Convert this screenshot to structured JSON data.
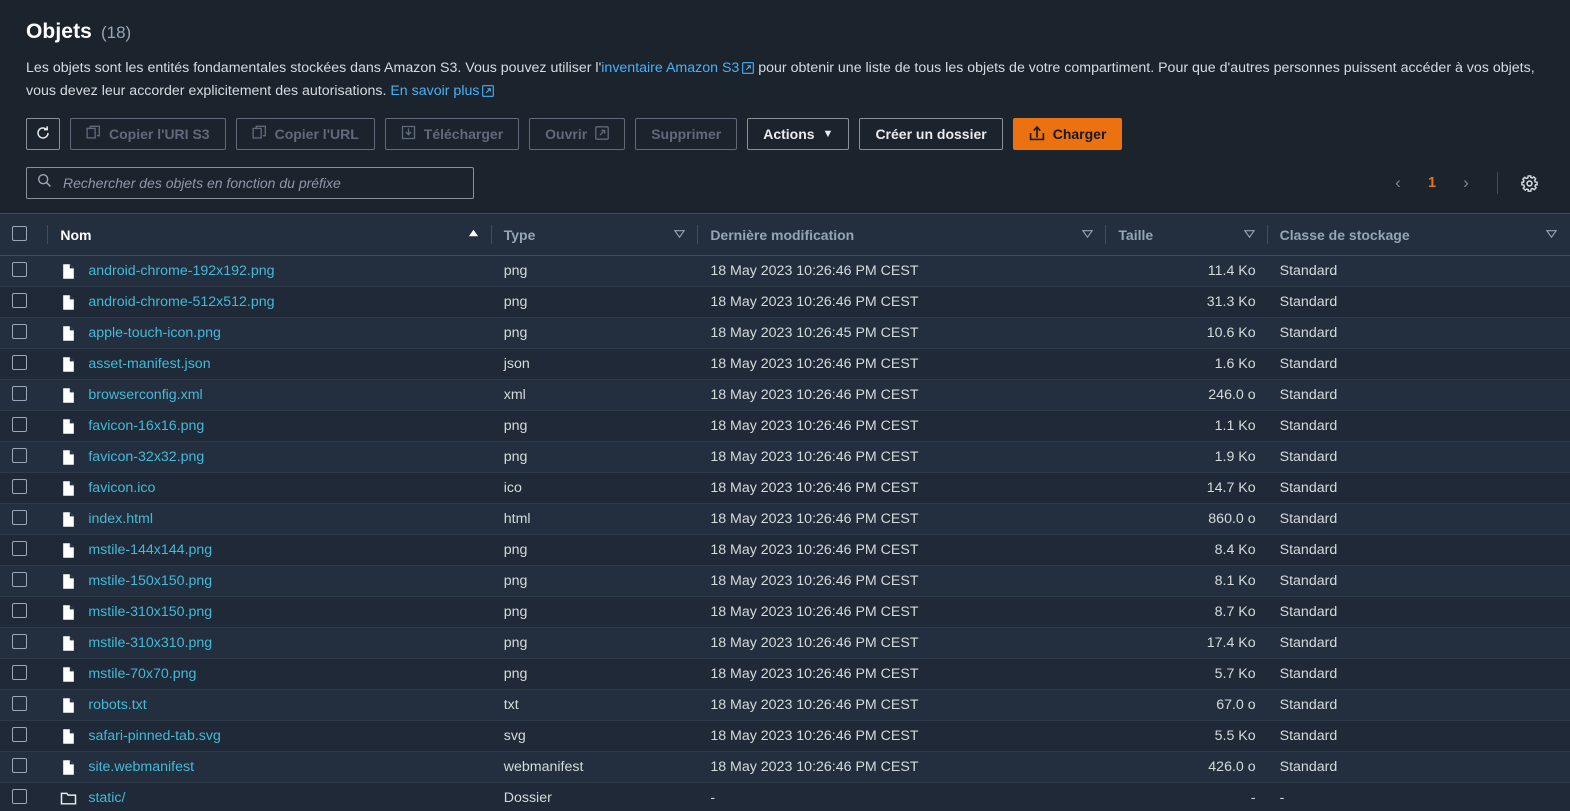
{
  "header": {
    "title": "Objets",
    "count": "(18)",
    "description_part1": "Les objets sont les entités fondamentales stockées dans Amazon S3. Vous pouvez utiliser l'",
    "inventory_link": "inventaire Amazon S3",
    "description_part2": " pour obtenir une liste de tous les objets de votre compartiment. Pour que d'autres personnes puissent accéder à vos objets, vous devez leur accorder explicitement des autorisations. ",
    "learn_more_link": "En savoir plus"
  },
  "toolbar": {
    "refresh_icon": "refresh-icon",
    "copy_uri_label": "Copier l'URI S3",
    "copy_url_label": "Copier l'URL",
    "download_label": "Télécharger",
    "open_label": "Ouvrir",
    "delete_label": "Supprimer",
    "actions_label": "Actions",
    "actions_caret": "▼",
    "create_folder_label": "Créer un dossier",
    "upload_label": "Charger"
  },
  "search": {
    "placeholder": "Rechercher des objets en fonction du préfixe",
    "value": ""
  },
  "pagination": {
    "prev": "‹",
    "page": "1",
    "next": "›",
    "settings_icon": "gear-icon"
  },
  "table": {
    "columns": [
      {
        "label": "Nom",
        "sort": "asc"
      },
      {
        "label": "Type",
        "sort": "none"
      },
      {
        "label": "Dernière modification",
        "sort": "none"
      },
      {
        "label": "Taille",
        "sort": "none"
      },
      {
        "label": "Classe de stockage",
        "sort": "none"
      }
    ],
    "rows": [
      {
        "name": "android-chrome-192x192.png",
        "icon": "file-icon",
        "type": "png",
        "modified": "18 May 2023 10:26:46 PM CEST",
        "size": "11.4 Ko",
        "storage_class": "Standard"
      },
      {
        "name": "android-chrome-512x512.png",
        "icon": "file-icon",
        "type": "png",
        "modified": "18 May 2023 10:26:46 PM CEST",
        "size": "31.3 Ko",
        "storage_class": "Standard"
      },
      {
        "name": "apple-touch-icon.png",
        "icon": "file-icon",
        "type": "png",
        "modified": "18 May 2023 10:26:45 PM CEST",
        "size": "10.6 Ko",
        "storage_class": "Standard"
      },
      {
        "name": "asset-manifest.json",
        "icon": "file-icon",
        "type": "json",
        "modified": "18 May 2023 10:26:46 PM CEST",
        "size": "1.6 Ko",
        "storage_class": "Standard"
      },
      {
        "name": "browserconfig.xml",
        "icon": "file-icon",
        "type": "xml",
        "modified": "18 May 2023 10:26:46 PM CEST",
        "size": "246.0 o",
        "storage_class": "Standard"
      },
      {
        "name": "favicon-16x16.png",
        "icon": "file-icon",
        "type": "png",
        "modified": "18 May 2023 10:26:46 PM CEST",
        "size": "1.1 Ko",
        "storage_class": "Standard"
      },
      {
        "name": "favicon-32x32.png",
        "icon": "file-icon",
        "type": "png",
        "modified": "18 May 2023 10:26:46 PM CEST",
        "size": "1.9 Ko",
        "storage_class": "Standard"
      },
      {
        "name": "favicon.ico",
        "icon": "file-icon",
        "type": "ico",
        "modified": "18 May 2023 10:26:46 PM CEST",
        "size": "14.7 Ko",
        "storage_class": "Standard"
      },
      {
        "name": "index.html",
        "icon": "file-icon",
        "type": "html",
        "modified": "18 May 2023 10:26:46 PM CEST",
        "size": "860.0 o",
        "storage_class": "Standard"
      },
      {
        "name": "mstile-144x144.png",
        "icon": "file-icon",
        "type": "png",
        "modified": "18 May 2023 10:26:46 PM CEST",
        "size": "8.4 Ko",
        "storage_class": "Standard"
      },
      {
        "name": "mstile-150x150.png",
        "icon": "file-icon",
        "type": "png",
        "modified": "18 May 2023 10:26:46 PM CEST",
        "size": "8.1 Ko",
        "storage_class": "Standard"
      },
      {
        "name": "mstile-310x150.png",
        "icon": "file-icon",
        "type": "png",
        "modified": "18 May 2023 10:26:46 PM CEST",
        "size": "8.7 Ko",
        "storage_class": "Standard"
      },
      {
        "name": "mstile-310x310.png",
        "icon": "file-icon",
        "type": "png",
        "modified": "18 May 2023 10:26:46 PM CEST",
        "size": "17.4 Ko",
        "storage_class": "Standard"
      },
      {
        "name": "mstile-70x70.png",
        "icon": "file-icon",
        "type": "png",
        "modified": "18 May 2023 10:26:46 PM CEST",
        "size": "5.7 Ko",
        "storage_class": "Standard"
      },
      {
        "name": "robots.txt",
        "icon": "file-icon",
        "type": "txt",
        "modified": "18 May 2023 10:26:46 PM CEST",
        "size": "67.0 o",
        "storage_class": "Standard"
      },
      {
        "name": "safari-pinned-tab.svg",
        "icon": "file-icon",
        "type": "svg",
        "modified": "18 May 2023 10:26:46 PM CEST",
        "size": "5.5 Ko",
        "storage_class": "Standard"
      },
      {
        "name": "site.webmanifest",
        "icon": "file-icon",
        "type": "webmanifest",
        "modified": "18 May 2023 10:26:46 PM CEST",
        "size": "426.0 o",
        "storage_class": "Standard"
      },
      {
        "name": "static/",
        "icon": "folder-icon",
        "type": "Dossier",
        "modified": "-",
        "size": "-",
        "storage_class": "-"
      }
    ]
  },
  "colors": {
    "accent_orange": "#ec7211",
    "link_blue": "#44b9d6",
    "bg_dark": "#1b232d",
    "row_bg": "#232f3e"
  }
}
